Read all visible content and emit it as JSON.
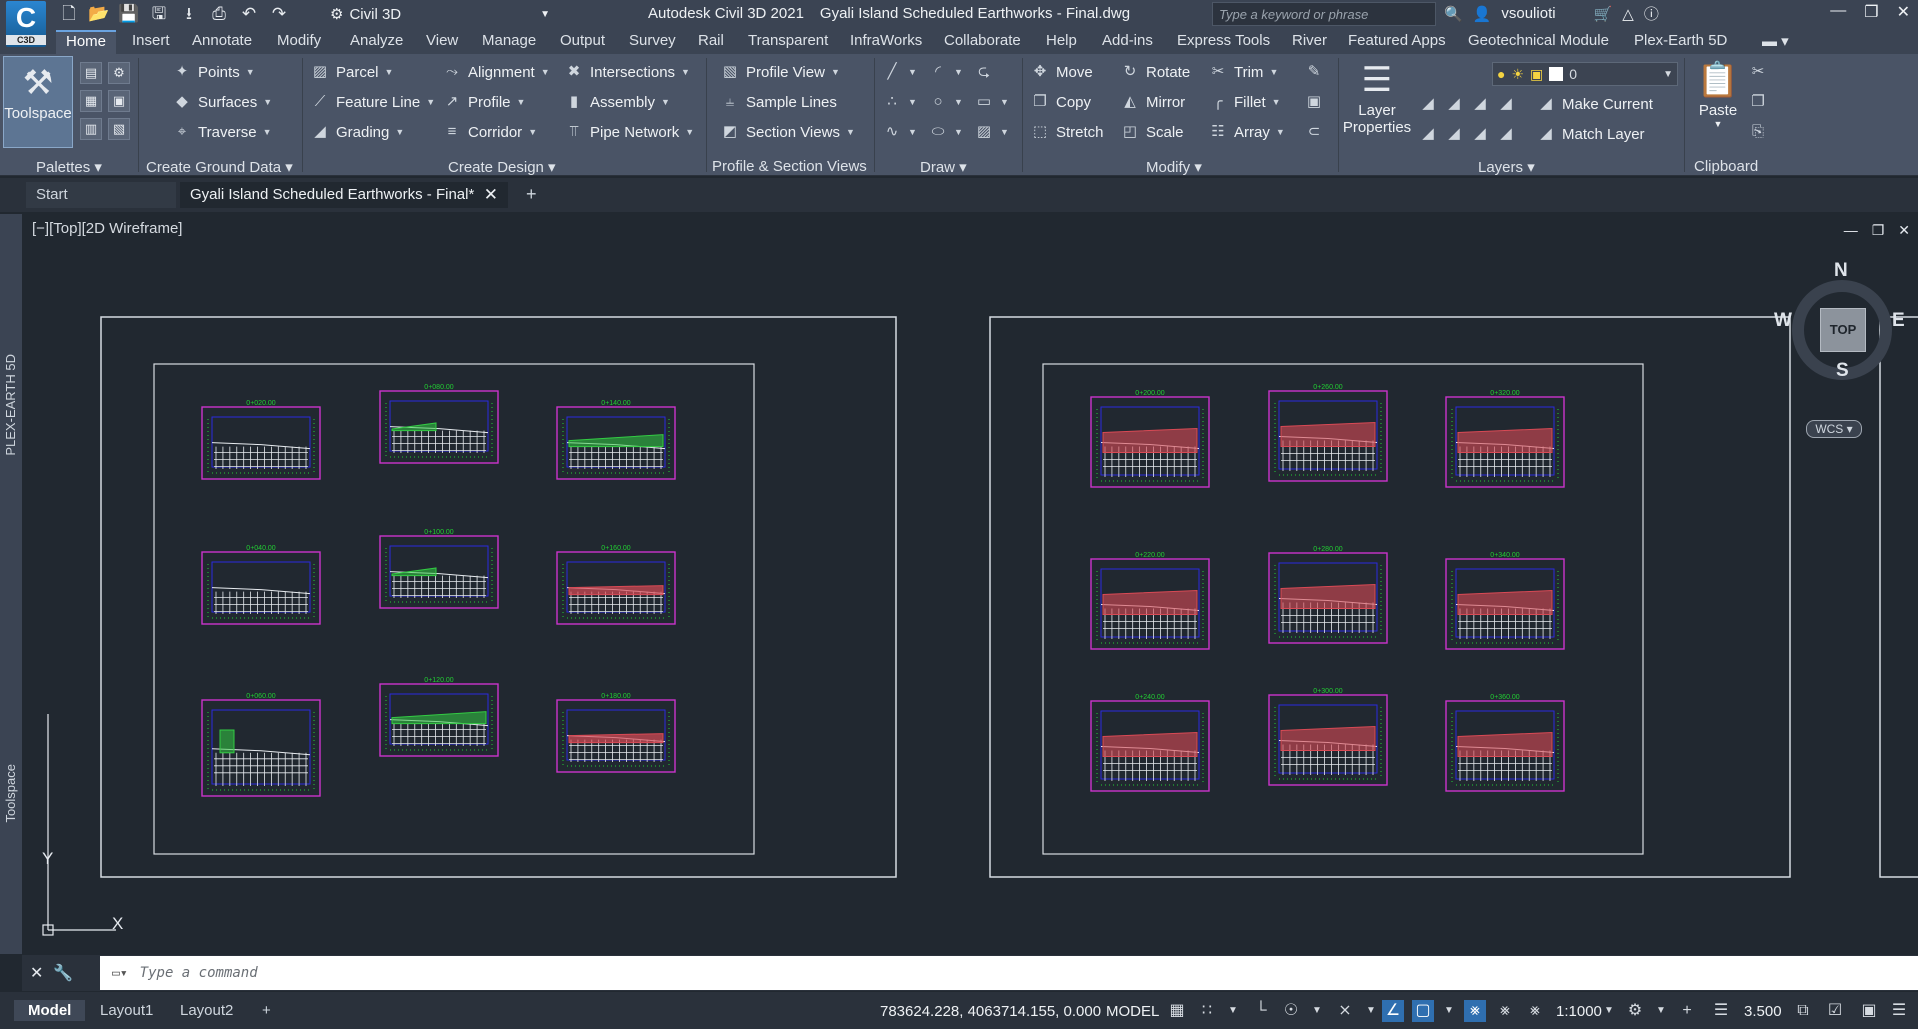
{
  "app": {
    "logo_text": "C",
    "logo_sub": "C3D",
    "workspace": "Civil 3D",
    "product": "Autodesk Civil 3D 2021",
    "filename": "Gyali Island Scheduled Earthworks - Final.dwg",
    "search_placeholder": "Type a keyword or phrase",
    "user": "vsoulioti"
  },
  "ribbon_tabs": [
    "Home",
    "Insert",
    "Annotate",
    "Modify",
    "Analyze",
    "View",
    "Manage",
    "Output",
    "Survey",
    "Rail",
    "Transparent",
    "InfraWorks",
    "Collaborate",
    "Help",
    "Add-ins",
    "Express Tools",
    "River",
    "Featured Apps",
    "Geotechnical Module",
    "Plex-Earth 5D"
  ],
  "ribbon": {
    "toolspace": "Toolspace",
    "points": "Points",
    "surfaces": "Surfaces",
    "traverse": "Traverse",
    "parcel": "Parcel",
    "feature_line": "Feature Line",
    "grading": "Grading",
    "alignment": "Alignment",
    "profile": "Profile",
    "corridor": "Corridor",
    "intersections": "Intersections",
    "assembly": "Assembly",
    "pipe_network": "Pipe Network",
    "profile_view": "Profile View",
    "sample_lines": "Sample Lines",
    "section_views": "Section Views",
    "move": "Move",
    "copy": "Copy",
    "stretch": "Stretch",
    "rotate": "Rotate",
    "mirror": "Mirror",
    "scale": "Scale",
    "trim": "Trim",
    "fillet": "Fillet",
    "array": "Array",
    "layer_properties_1": "Layer",
    "layer_properties_2": "Properties",
    "layer_name": "0",
    "make_current": "Make Current",
    "match_layer": "Match Layer",
    "paste": "Paste",
    "panels": {
      "palettes": "Palettes",
      "create_ground_data": "Create Ground Data",
      "create_design": "Create Design",
      "profile_section_views": "Profile & Section Views",
      "draw": "Draw",
      "modify": "Modify",
      "layers": "Layers",
      "clipboard": "Clipboard"
    }
  },
  "file_tabs": {
    "start": "Start",
    "document": "Gyali Island Scheduled Earthworks - Final*"
  },
  "left_strip": {
    "top_label": "PLEX-EARTH 5D",
    "bottom_label": "Toolspace"
  },
  "viewport": {
    "label": "[−][Top][2D Wireframe]",
    "viewcube_top": "TOP",
    "north": "N",
    "south": "S",
    "east": "E",
    "west": "W",
    "wcs": "WCS",
    "ucs_y": "Y",
    "ucs_x": "X"
  },
  "drawing": {
    "left_sheet_sections": [
      {
        "station": "0+020.00",
        "fill": "none"
      },
      {
        "station": "0+080.00",
        "fill": "cut"
      },
      {
        "station": "0+140.00",
        "fill": "cut-thin"
      },
      {
        "station": "0+040.00",
        "fill": "none"
      },
      {
        "station": "0+100.00",
        "fill": "cut"
      },
      {
        "station": "0+160.00",
        "fill": "fill-thin"
      },
      {
        "station": "0+060.00",
        "fill": "cut-small"
      },
      {
        "station": "0+120.00",
        "fill": "cut-thin"
      },
      {
        "station": "0+180.00",
        "fill": "fill-thin"
      }
    ],
    "right_sheet_sections": [
      {
        "station": "0+200.00",
        "fill": "fill"
      },
      {
        "station": "0+260.00",
        "fill": "fill"
      },
      {
        "station": "0+320.00",
        "fill": "fill"
      },
      {
        "station": "0+220.00",
        "fill": "fill"
      },
      {
        "station": "0+280.00",
        "fill": "fill"
      },
      {
        "station": "0+340.00",
        "fill": "fill"
      },
      {
        "station": "0+240.00",
        "fill": "fill"
      },
      {
        "station": "0+300.00",
        "fill": "fill"
      },
      {
        "station": "0+360.00",
        "fill": "fill"
      }
    ],
    "colors": {
      "sheet_border": "#d6dbe1",
      "section_frame": "#cc33cc",
      "section_grid": "#e8ecf0",
      "design_line": "#2a2ae0",
      "label": "#22cc33",
      "cut": "#33cc44",
      "fill": "#d94a55"
    }
  },
  "command_line": {
    "placeholder": "Type a command"
  },
  "status_bar": {
    "layout_tabs": [
      "Model",
      "Layout1",
      "Layout2"
    ],
    "coordinates": "783624.228, 4063714.155, 0.000",
    "mode": "MODEL",
    "annotation_scale": "1:1000",
    "lineweight": "3.500"
  }
}
